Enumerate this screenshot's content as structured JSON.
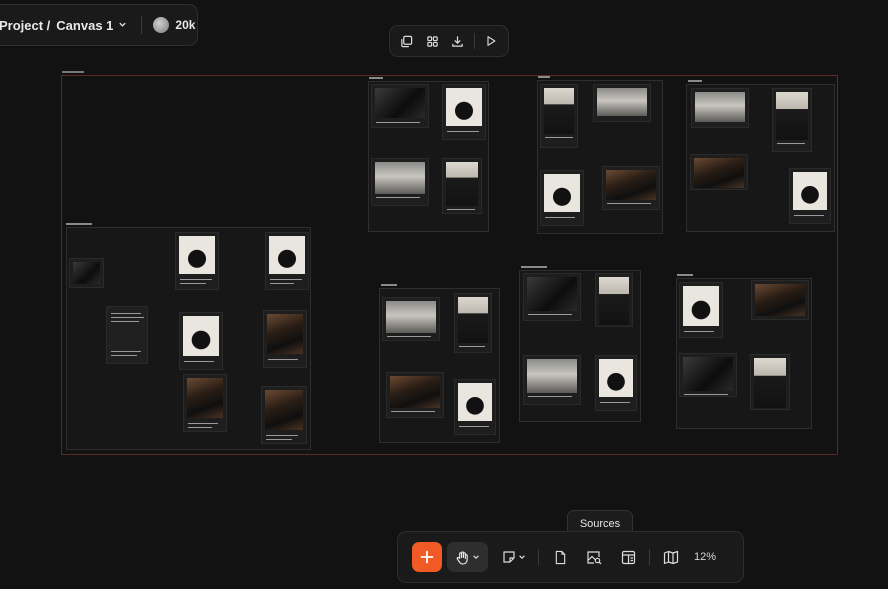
{
  "header": {
    "project_label": "Project /",
    "canvas_name": "Canvas 1",
    "credits": "20k"
  },
  "top_toolbar": {
    "icons": [
      "copy-icon",
      "grid-icon",
      "download-icon",
      "play-icon"
    ]
  },
  "bottom_toolbar": {
    "tooltip": "Sources",
    "zoom": "12%",
    "icons": [
      "plus-icon",
      "hand-icon",
      "sticky-note-icon",
      "file-icon",
      "image-search-icon",
      "layout-icon",
      "map-icon"
    ],
    "accent": "#f15a24"
  }
}
